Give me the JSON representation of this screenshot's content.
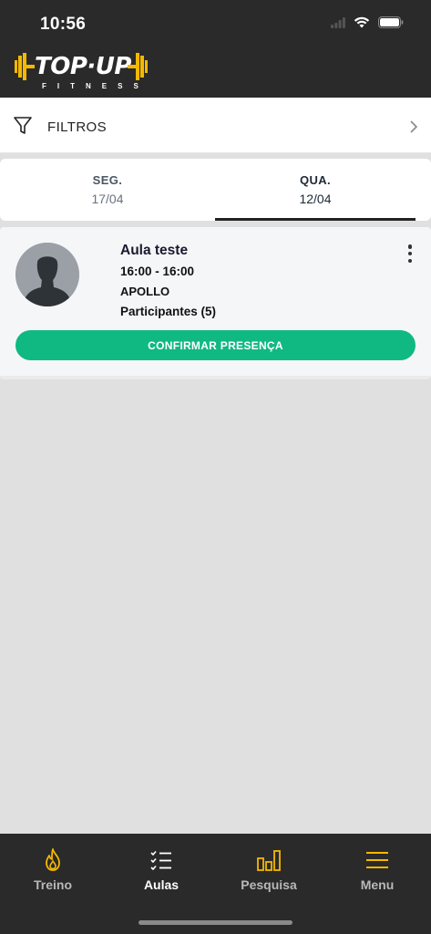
{
  "status_bar": {
    "time": "10:56"
  },
  "brand": {
    "logo_main": "TOP·UP",
    "logo_sub": "FITNESS"
  },
  "filters": {
    "label": "FILTROS"
  },
  "tabs": [
    {
      "day": "SEG.",
      "date": "17/04",
      "active": false
    },
    {
      "day": "QUA.",
      "date": "12/04",
      "active": true
    }
  ],
  "class_card": {
    "title": "Aula teste",
    "time": "16:00 - 16:00",
    "instructor": "APOLLO",
    "participants": "Participantes (5)",
    "confirm_label": "CONFIRMAR PRESENÇA"
  },
  "bottom_nav": {
    "items": [
      {
        "label": "Treino",
        "icon": "flame-icon",
        "active": false
      },
      {
        "label": "Aulas",
        "icon": "checklist-icon",
        "active": true
      },
      {
        "label": "Pesquisa",
        "icon": "bar-chart-icon",
        "active": false
      },
      {
        "label": "Menu",
        "icon": "hamburger-menu-icon",
        "active": false
      }
    ]
  },
  "colors": {
    "header_bg": "#2a2a2a",
    "accent_yellow": "#f5b800",
    "confirm_green": "#10b981",
    "content_bg": "#e0e0e0"
  }
}
